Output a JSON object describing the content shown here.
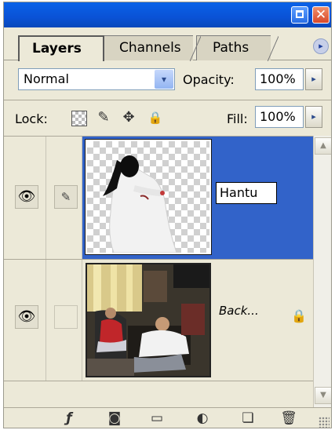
{
  "window": {
    "minimize_icon": "minimize-icon",
    "close_glyph": "✕"
  },
  "tabs": [
    {
      "label": "Layers",
      "active": true
    },
    {
      "label": "Channels",
      "active": false
    },
    {
      "label": "Paths",
      "active": false
    }
  ],
  "menu_glyph": "▸",
  "blend": {
    "mode": "Normal",
    "opacity_label": "Opacity:",
    "opacity_value": "100%",
    "arrow_glyph": "▸",
    "dropdown_glyph": "▾"
  },
  "lock": {
    "label": "Lock:",
    "fill_label": "Fill:",
    "fill_value": "100%",
    "icons": [
      "lock-transparency-icon",
      "lock-image-brush-icon",
      "lock-position-move-icon",
      "lock-all-padlock-icon"
    ],
    "brush_glyph": "✎",
    "move_glyph": "✥",
    "padlock_glyph": "🔒"
  },
  "layers": [
    {
      "name": "Hantu",
      "visible": true,
      "selected": true,
      "editing_name": true,
      "brush_glyph": "✎"
    },
    {
      "name": "Back...",
      "visible": true,
      "selected": false,
      "locked": true,
      "padlock_glyph": "🔒"
    }
  ],
  "eye_glyph": "👁",
  "scroll": {
    "up_glyph": "▲",
    "down_glyph": "▼"
  },
  "bottom_toolbar": {
    "icons": [
      "layer-style-icon",
      "layer-mask-icon",
      "new-group-folder-icon",
      "adjustment-layer-icon",
      "new-layer-icon",
      "trash-icon"
    ],
    "glyphs": [
      "ƒ",
      "◙",
      "▭",
      "◐",
      "❏",
      "🗑"
    ]
  },
  "colors": {
    "selection": "#3263c9",
    "titlebar": "#0a52d6",
    "panel": "#ece9d8"
  }
}
